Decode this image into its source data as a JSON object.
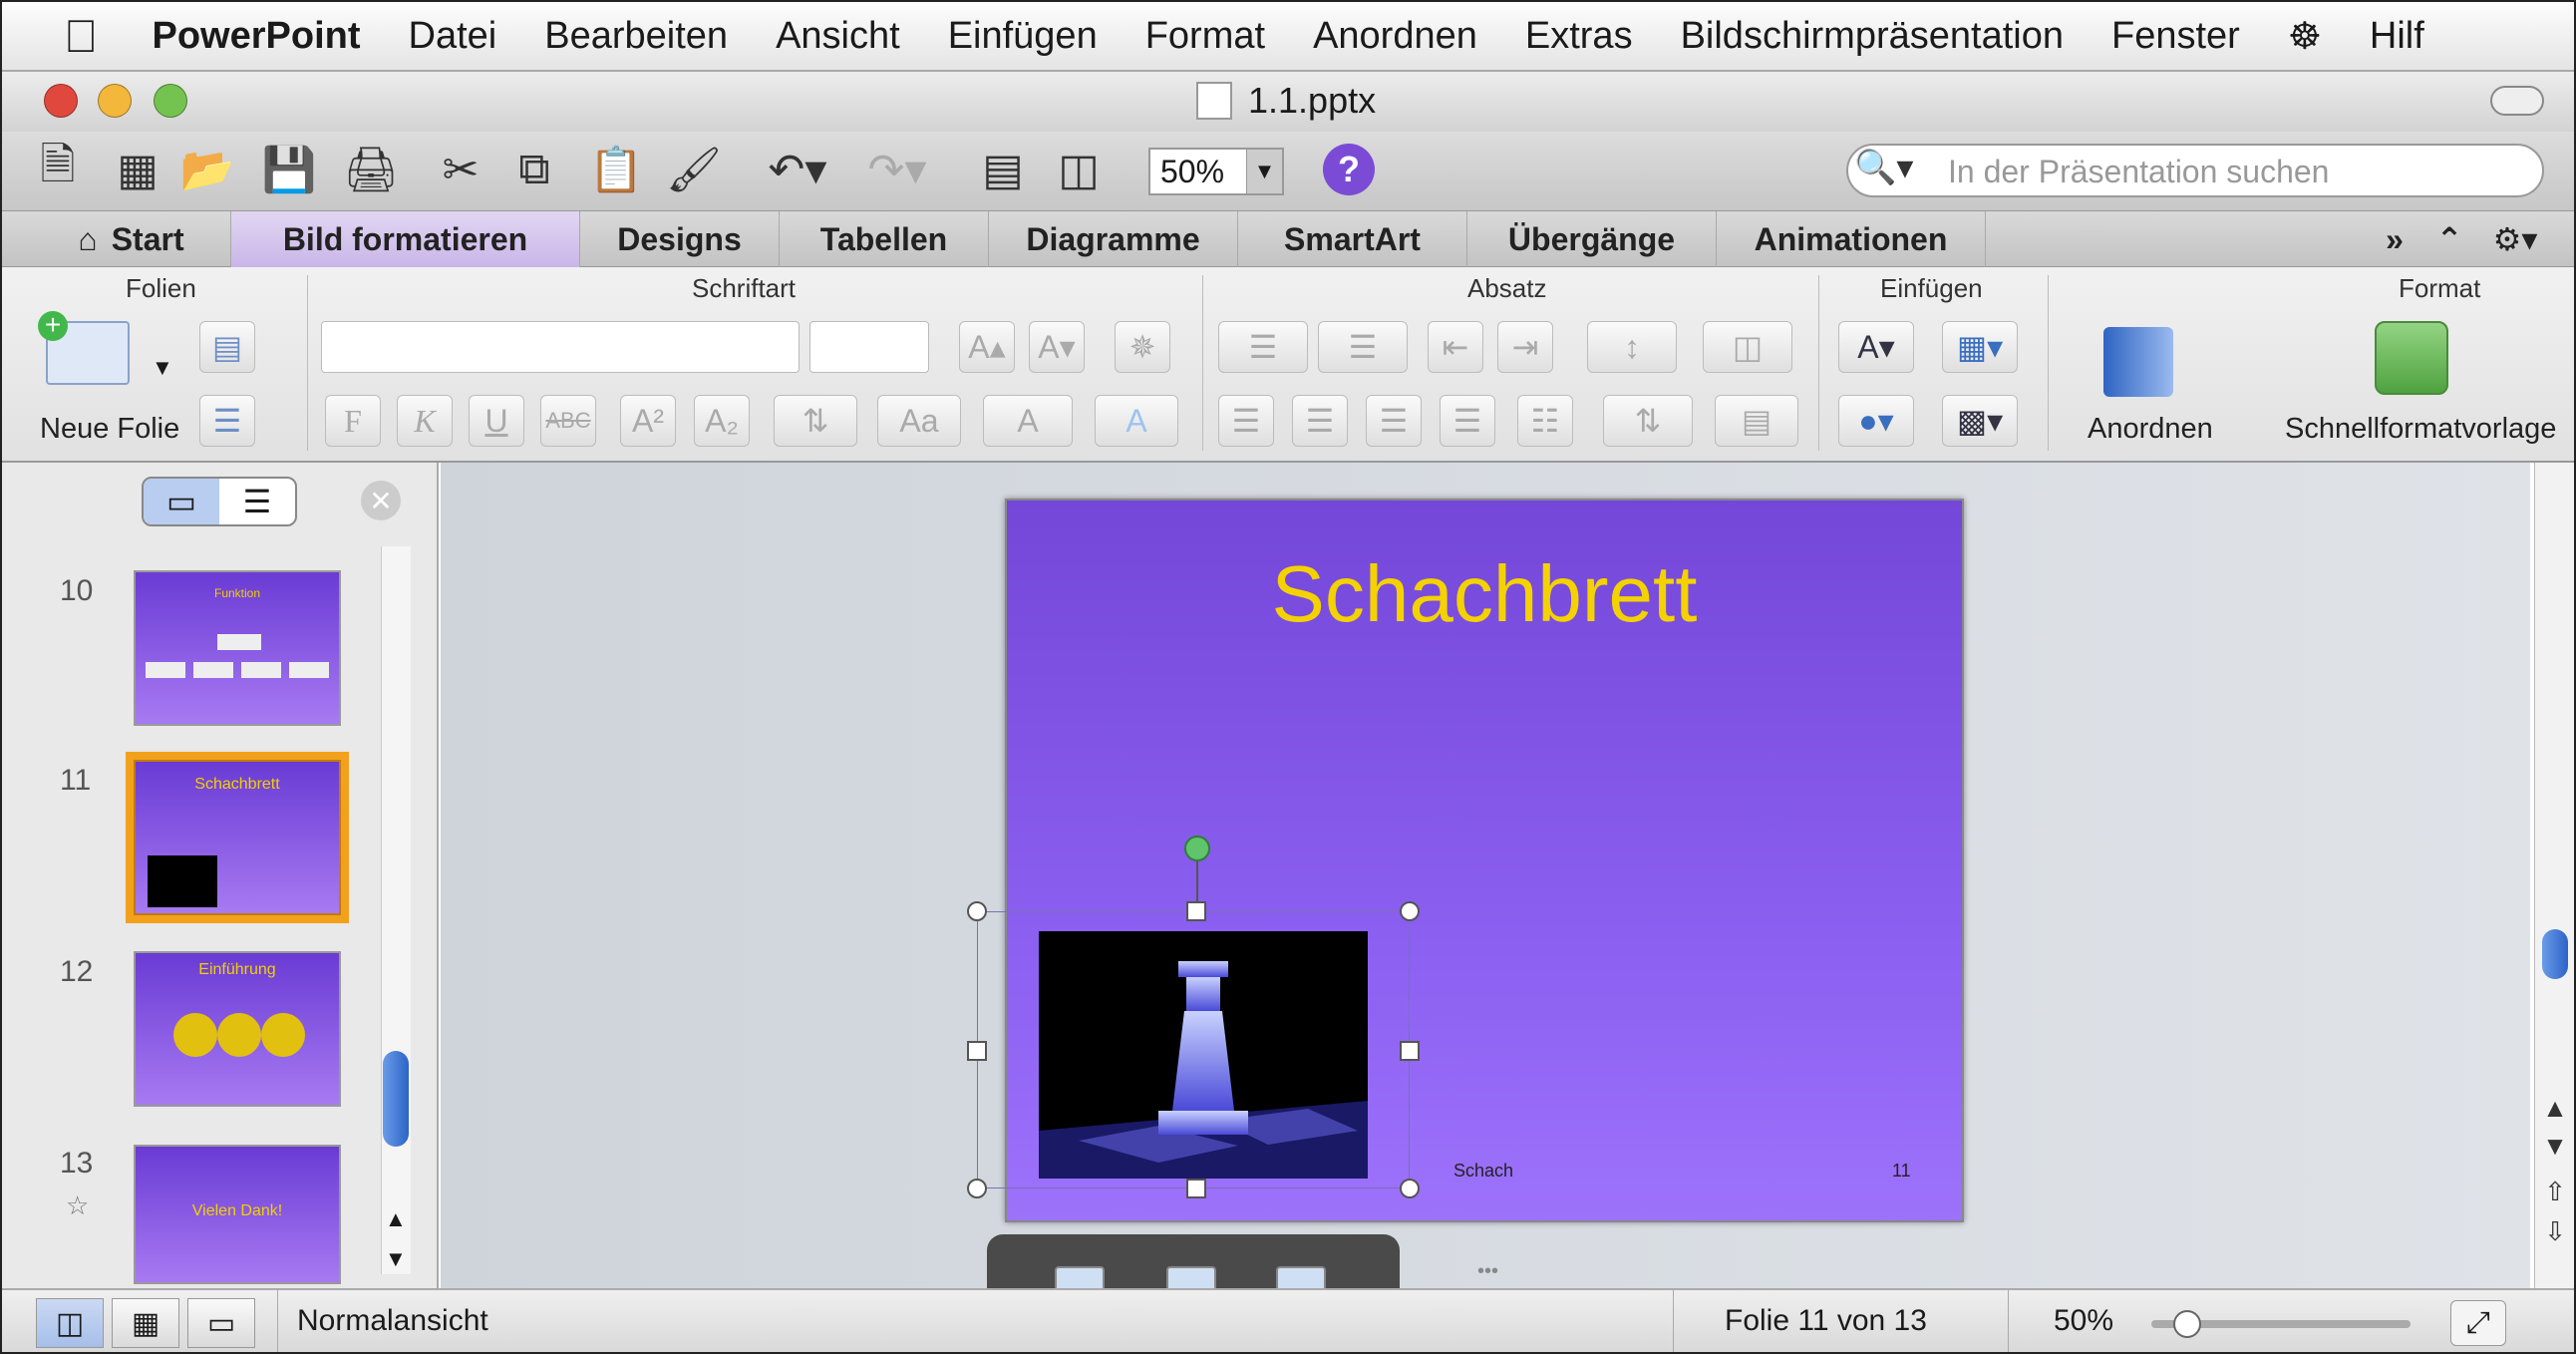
{
  "menubar": {
    "apple": "",
    "app": "PowerPoint",
    "items": [
      "Datei",
      "Bearbeiten",
      "Ansicht",
      "Einfügen",
      "Format",
      "Anordnen",
      "Extras",
      "Bildschirmpräsentation",
      "Fenster",
      "Hilf"
    ],
    "script_icon": "script-menu-icon"
  },
  "window": {
    "title": "1.1.pptx"
  },
  "toolbar": {
    "zoom": "50%",
    "search_placeholder": "In der Präsentation suchen",
    "icons": [
      "new-icon",
      "gallery-icon",
      "open-icon",
      "save-icon",
      "print-icon",
      "cut-icon",
      "copy-icon",
      "paste-icon",
      "format-painter-icon",
      "undo-icon",
      "redo-icon",
      "slides-icon",
      "media-browser-icon",
      "help-icon"
    ]
  },
  "tabs": [
    "Start",
    "Bild formatieren",
    "Designs",
    "Tabellen",
    "Diagramme",
    "SmartArt",
    "Übergänge",
    "Animationen"
  ],
  "ribbon": {
    "groups": [
      "Folien",
      "Schriftart",
      "Absatz",
      "Einfügen",
      "Format"
    ],
    "new_slide": "Neue Folie",
    "arrange": "Anordnen",
    "quick_styles": "Schnellformatvorlage",
    "bold": "F",
    "italic": "K",
    "underline": "U",
    "strike": "ABC"
  },
  "slides": [
    {
      "number": "10",
      "title": "Funktion"
    },
    {
      "number": "11",
      "title": "Schachbrett"
    },
    {
      "number": "12",
      "title": "Einführung"
    },
    {
      "number": "13",
      "title": "Vielen Dank!"
    }
  ],
  "current_slide": {
    "title": "Schachbrett",
    "footer": "Schach",
    "number": "11"
  },
  "status": {
    "view": "Normalansicht",
    "slide_info": "Folie 11 von 13",
    "zoom": "50%"
  },
  "colors": {
    "accent": "#f2a11c",
    "slide_title": "#f4d200",
    "slide_bg_top": "#7447d8",
    "slide_bg_bottom": "#9d72fb"
  }
}
